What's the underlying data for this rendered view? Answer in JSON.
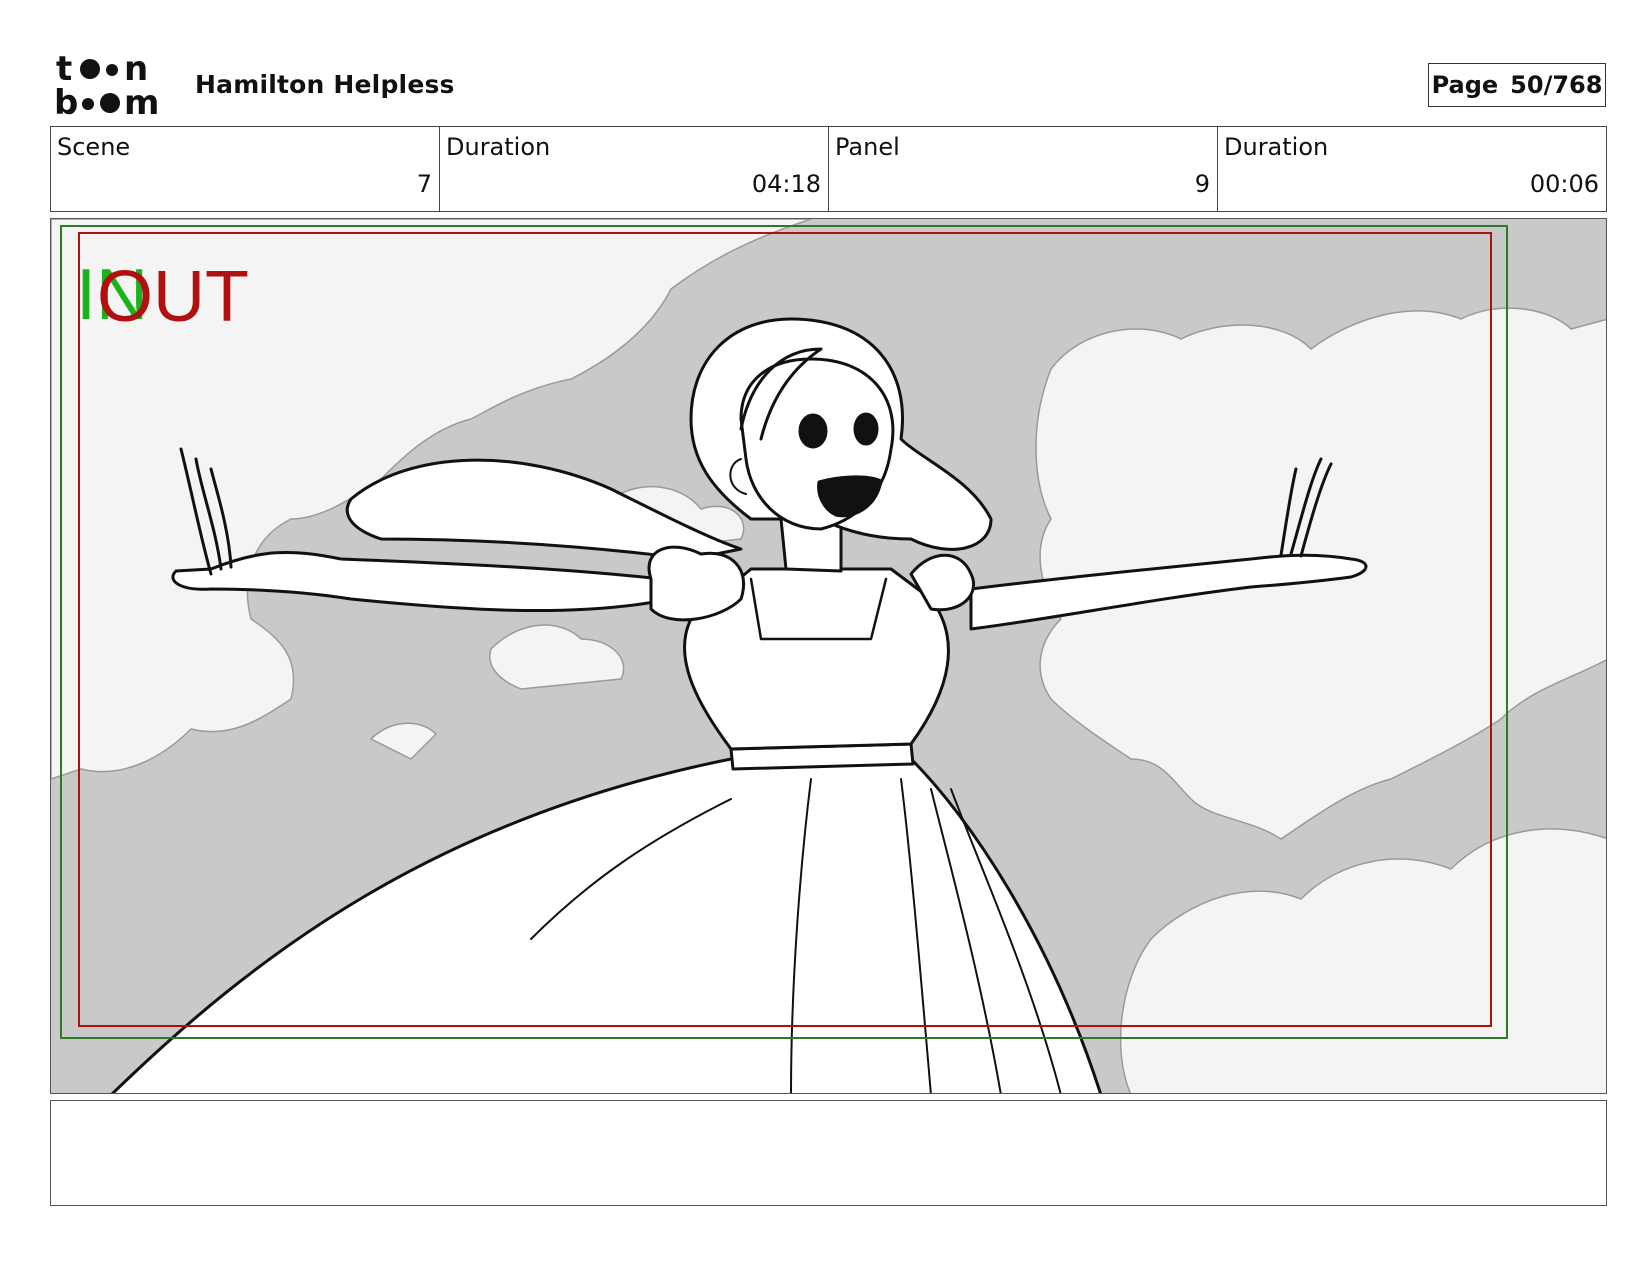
{
  "header": {
    "logo_text": "toon boom",
    "project_title": "Hamilton Helpless",
    "page_label": "Page",
    "page_number": "50/768"
  },
  "info": [
    {
      "label": "Scene",
      "value": "7"
    },
    {
      "label": "Duration",
      "value": "04:18"
    },
    {
      "label": "Panel",
      "value": "9"
    },
    {
      "label": "Duration",
      "value": "00:06"
    }
  ],
  "panel": {
    "in_marker": "IN",
    "out_marker": "OUT",
    "colors": {
      "in_marker": "#1bb31b",
      "out_marker": "#b01010",
      "safe_frame": "#b01010",
      "camera_frame": "#2a7a2a",
      "sky": "#c9c9c9",
      "cloud": "#f4f4f4"
    }
  },
  "notes": {
    "text": ""
  }
}
